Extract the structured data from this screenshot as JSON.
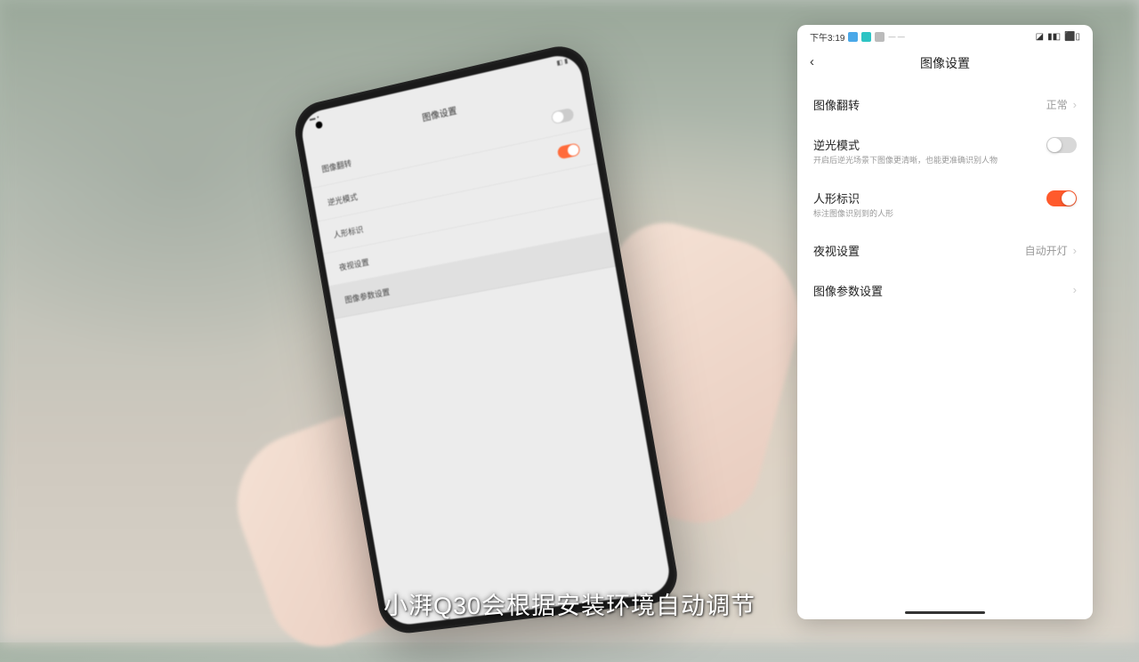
{
  "status_bar": {
    "time": "下午3:19",
    "right": "◪ ▬ ▮◧ ⬛"
  },
  "header": {
    "title": "图像设置"
  },
  "settings": {
    "rotation": {
      "label": "图像翻转",
      "value": "正常"
    },
    "backlight": {
      "label": "逆光模式",
      "desc": "开启后逆光场景下图像更清晰，也能更准确识别人物",
      "on": false
    },
    "human": {
      "label": "人形标识",
      "desc": "标注图像识别到的人形",
      "on": true
    },
    "night": {
      "label": "夜视设置",
      "value": "自动开灯"
    },
    "params": {
      "label": "图像参数设置"
    }
  },
  "subtitle": "小湃Q30会根据安装环境自动调节",
  "held_phone": {
    "title": "图像设置",
    "rows": [
      "图像翻转",
      "逆光模式",
      "人形标识",
      "夜视设置",
      "图像参数设置"
    ]
  }
}
